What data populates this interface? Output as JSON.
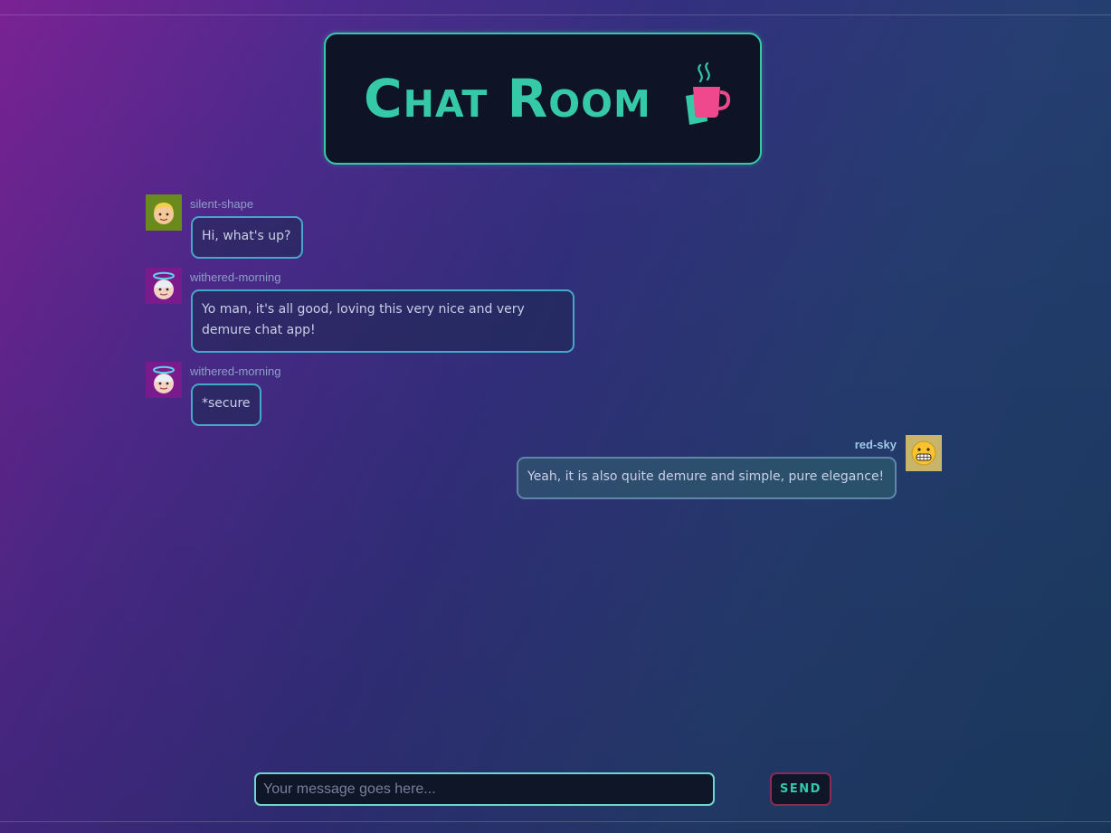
{
  "header": {
    "title": "Chat Room",
    "icon": "coffee-cup-icon"
  },
  "messages": [
    {
      "user": "silent-shape",
      "text": "Hi, what's up?",
      "avatar": "boy-face-icon",
      "avatar_bg": "#6a8a1e"
    },
    {
      "user": "withered-morning",
      "text": "Yo man, it's all good, loving this very nice and very demure chat app!",
      "avatar": "angel-face-icon",
      "avatar_bg": "#7a1a8c"
    },
    {
      "user": "withered-morning",
      "text": "*secure",
      "avatar": "angel-face-icon",
      "avatar_bg": "#7a1a8c"
    },
    {
      "user": "red-sky",
      "text": "Yeah, it is also quite demure and simple, pure elegance!",
      "avatar": "grimacing-face-icon",
      "avatar_bg": "#c8b46a",
      "own": true
    }
  ],
  "composer": {
    "placeholder": "Your message goes here...",
    "value": "",
    "send_label": "SEND"
  },
  "colors": {
    "accent": "#35c9a8",
    "send_border": "#8a2a55",
    "bubble_border": "#46a8c8"
  }
}
